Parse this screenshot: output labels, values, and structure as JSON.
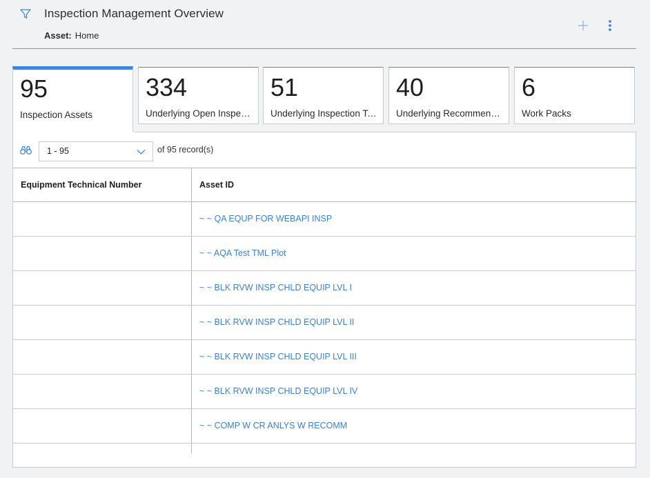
{
  "header": {
    "title": "Inspection Management Overview",
    "context_label": "Asset:",
    "context_value": "Home"
  },
  "icons": {
    "filter": "filter-icon",
    "add": "plus-icon",
    "more": "more-vertical-icon",
    "search": "binoculars-icon",
    "dropdown": "chevron-down-icon"
  },
  "colors": {
    "accent": "#3f86d8",
    "link": "#3b7fd0",
    "background": "#f1f2f4"
  },
  "tiles": [
    {
      "count": "95",
      "label": "Inspection Assets",
      "active": true
    },
    {
      "count": "334",
      "label": "Underlying Open Inspections",
      "active": false
    },
    {
      "count": "51",
      "label": "Underlying Inspection Tasks",
      "active": false
    },
    {
      "count": "40",
      "label": "Underlying Recommendations",
      "active": false
    },
    {
      "count": "6",
      "label": "Work Packs",
      "active": false
    }
  ],
  "pager": {
    "range": "1 - 95",
    "records_text": "of 95 record(s)"
  },
  "table": {
    "columns": [
      "Equipment Technical Number",
      "Asset ID"
    ],
    "rows": [
      {
        "equipment_technical_number": "",
        "asset_id": "~ ~ QA EQUP FOR WEBAPI INSP"
      },
      {
        "equipment_technical_number": "",
        "asset_id": "~ ~ AQA Test TML Plot"
      },
      {
        "equipment_technical_number": "",
        "asset_id": "~ ~ BLK RVW INSP CHLD EQUIP LVL I"
      },
      {
        "equipment_technical_number": "",
        "asset_id": "~ ~ BLK RVW INSP CHLD EQUIP LVL II"
      },
      {
        "equipment_technical_number": "",
        "asset_id": "~ ~ BLK RVW INSP CHLD EQUIP LVL III"
      },
      {
        "equipment_technical_number": "",
        "asset_id": "~ ~ BLK RVW INSP CHLD EQUIP LVL IV"
      },
      {
        "equipment_technical_number": "",
        "asset_id": "~ ~ COMP W CR ANLYS W RECOMM"
      },
      {
        "equipment_technical_number": "",
        "asset_id": ""
      }
    ]
  }
}
